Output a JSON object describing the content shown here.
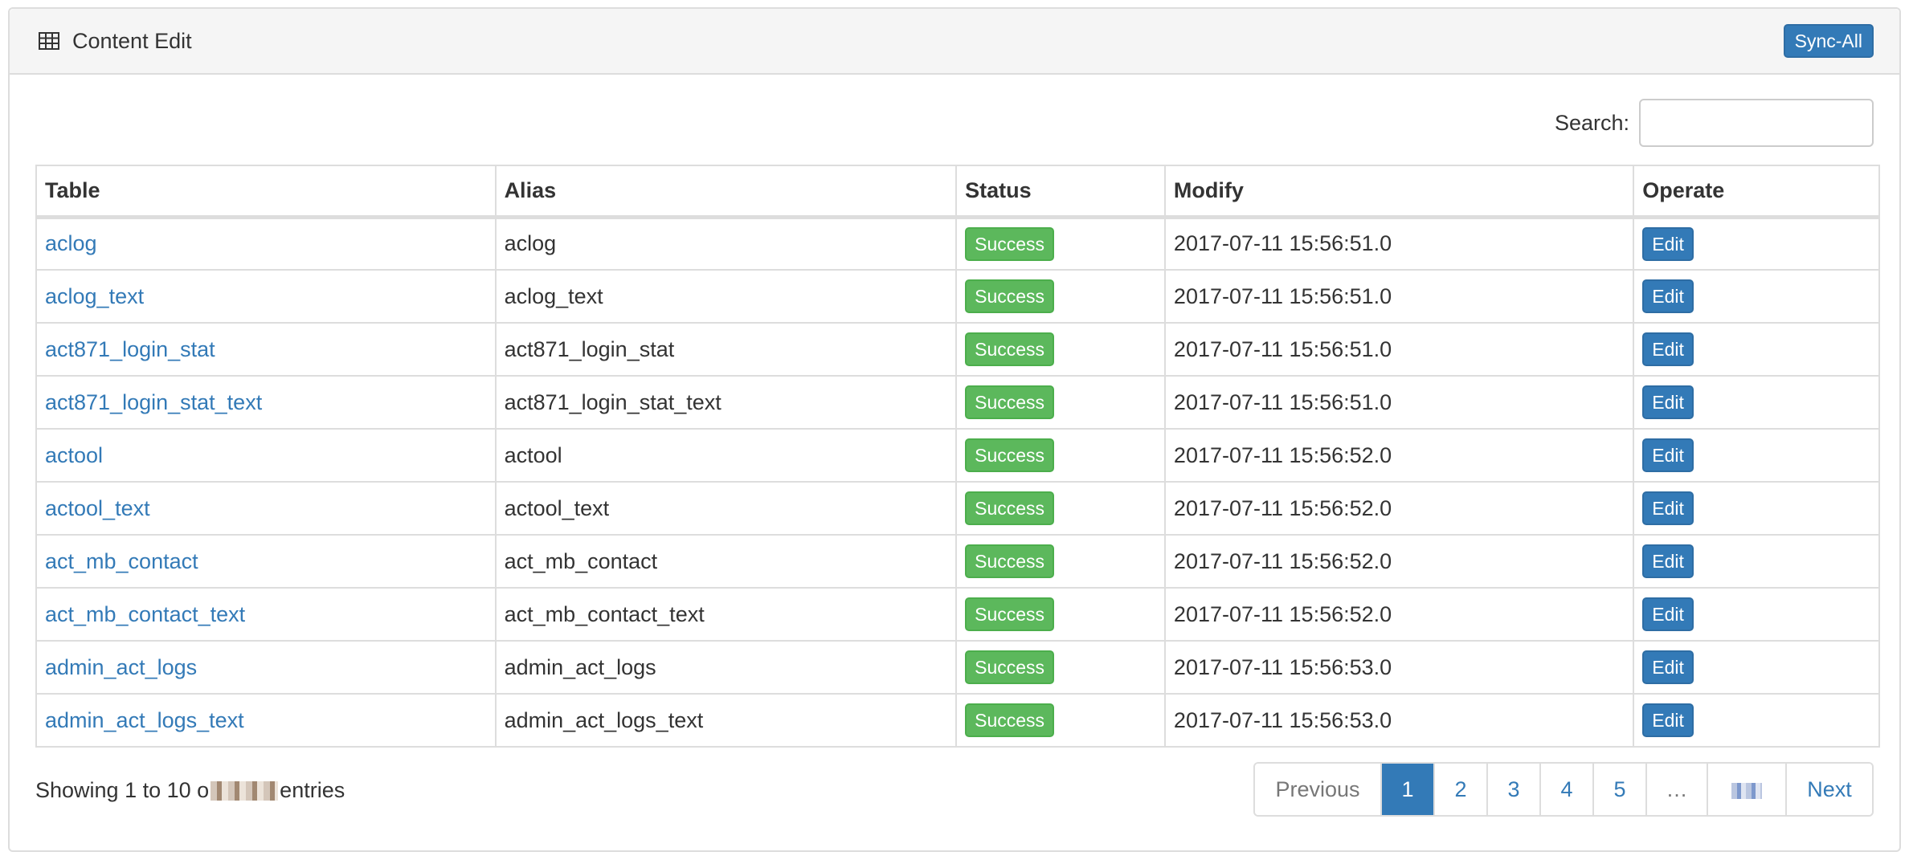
{
  "panel": {
    "title": "Content Edit",
    "sync_label": "Sync-All"
  },
  "search": {
    "label": "Search:",
    "value": "",
    "placeholder": ""
  },
  "table": {
    "headers": [
      "Table",
      "Alias",
      "Status",
      "Modify",
      "Operate"
    ],
    "edit_label": "Edit",
    "rows": [
      {
        "table": "aclog",
        "alias": "aclog",
        "status": "Success",
        "modify": "2017-07-11 15:56:51.0"
      },
      {
        "table": "aclog_text",
        "alias": "aclog_text",
        "status": "Success",
        "modify": "2017-07-11 15:56:51.0"
      },
      {
        "table": "act871_login_stat",
        "alias": "act871_login_stat",
        "status": "Success",
        "modify": "2017-07-11 15:56:51.0"
      },
      {
        "table": "act871_login_stat_text",
        "alias": "act871_login_stat_text",
        "status": "Success",
        "modify": "2017-07-11 15:56:51.0"
      },
      {
        "table": "actool",
        "alias": "actool",
        "status": "Success",
        "modify": "2017-07-11 15:56:52.0"
      },
      {
        "table": "actool_text",
        "alias": "actool_text",
        "status": "Success",
        "modify": "2017-07-11 15:56:52.0"
      },
      {
        "table": "act_mb_contact",
        "alias": "act_mb_contact",
        "status": "Success",
        "modify": "2017-07-11 15:56:52.0"
      },
      {
        "table": "act_mb_contact_text",
        "alias": "act_mb_contact_text",
        "status": "Success",
        "modify": "2017-07-11 15:56:52.0"
      },
      {
        "table": "admin_act_logs",
        "alias": "admin_act_logs",
        "status": "Success",
        "modify": "2017-07-11 15:56:53.0"
      },
      {
        "table": "admin_act_logs_text",
        "alias": "admin_act_logs_text",
        "status": "Success",
        "modify": "2017-07-11 15:56:53.0"
      }
    ]
  },
  "info": {
    "prefix": "Showing 1 to 10 o",
    "suffix": "entries"
  },
  "pagination": {
    "previous": "Previous",
    "pages": [
      "1",
      "2",
      "3",
      "4",
      "5"
    ],
    "active_page": "1",
    "ellipsis": "…",
    "next": "Next"
  },
  "colors": {
    "primary": "#337ab7",
    "success": "#5cb85c",
    "border": "#dddddd",
    "heading_bg": "#f5f5f5"
  }
}
